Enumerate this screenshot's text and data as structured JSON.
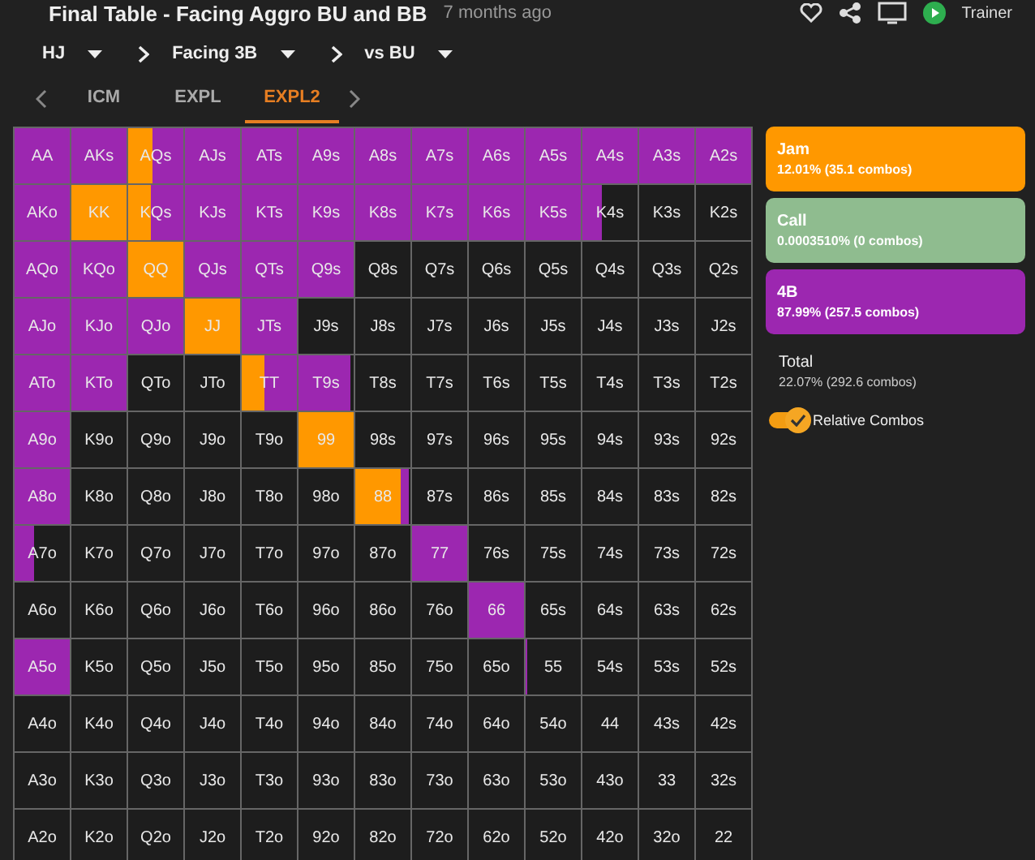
{
  "header": {
    "title": "Final Table - Facing Aggro BU and BB",
    "time": "7 months ago",
    "trainer_label": "Trainer"
  },
  "breadcrumbs": [
    {
      "label": "HJ"
    },
    {
      "label": "Facing 3B"
    },
    {
      "label": "vs BU"
    }
  ],
  "tabs": [
    {
      "label": "ICM",
      "selected": false
    },
    {
      "label": "EXPL",
      "selected": false
    },
    {
      "label": "EXPL2",
      "selected": true
    }
  ],
  "grid": [
    [
      {
        "hand": "AA",
        "segments": [
          {
            "kind": "fourbet",
            "level": 1
          }
        ]
      },
      {
        "hand": "AKs",
        "segments": [
          {
            "kind": "fourbet",
            "level": 1
          }
        ]
      },
      {
        "hand": "AQs",
        "segments": [
          {
            "kind": "jam",
            "level": 0.45
          },
          {
            "kind": "fourbet",
            "level": 0.55
          }
        ]
      },
      {
        "hand": "AJs",
        "segments": [
          {
            "kind": "fourbet",
            "level": 1
          }
        ]
      },
      {
        "hand": "ATs",
        "segments": [
          {
            "kind": "fourbet",
            "level": 1
          }
        ]
      },
      {
        "hand": "A9s",
        "segments": [
          {
            "kind": "fourbet",
            "level": 1
          }
        ]
      },
      {
        "hand": "A8s",
        "segments": [
          {
            "kind": "fourbet",
            "level": 1
          }
        ]
      },
      {
        "hand": "A7s",
        "segments": [
          {
            "kind": "fourbet",
            "level": 1
          }
        ]
      },
      {
        "hand": "A6s",
        "segments": [
          {
            "kind": "fourbet",
            "level": 1
          }
        ]
      },
      {
        "hand": "A5s",
        "segments": [
          {
            "kind": "fourbet",
            "level": 1
          }
        ]
      },
      {
        "hand": "A4s",
        "segments": [
          {
            "kind": "fourbet",
            "level": 1
          }
        ]
      },
      {
        "hand": "A3s",
        "segments": [
          {
            "kind": "fourbet",
            "level": 1
          }
        ]
      },
      {
        "hand": "A2s",
        "segments": [
          {
            "kind": "fourbet",
            "level": 1
          }
        ]
      }
    ],
    [
      {
        "hand": "AKo",
        "segments": [
          {
            "kind": "fourbet",
            "level": 1
          }
        ]
      },
      {
        "hand": "KK",
        "segments": [
          {
            "kind": "jam",
            "level": 1
          }
        ]
      },
      {
        "hand": "KQs",
        "segments": [
          {
            "kind": "jam",
            "level": 0.4
          },
          {
            "kind": "fourbet",
            "level": 0.6
          }
        ]
      },
      {
        "hand": "KJs",
        "segments": [
          {
            "kind": "fourbet",
            "level": 1
          }
        ]
      },
      {
        "hand": "KTs",
        "segments": [
          {
            "kind": "fourbet",
            "level": 1
          }
        ]
      },
      {
        "hand": "K9s",
        "segments": [
          {
            "kind": "fourbet",
            "level": 1
          }
        ]
      },
      {
        "hand": "K8s",
        "segments": [
          {
            "kind": "fourbet",
            "level": 1
          }
        ]
      },
      {
        "hand": "K7s",
        "segments": [
          {
            "kind": "fourbet",
            "level": 1
          }
        ]
      },
      {
        "hand": "K6s",
        "segments": [
          {
            "kind": "fourbet",
            "level": 1
          }
        ]
      },
      {
        "hand": "K5s",
        "segments": [
          {
            "kind": "fourbet",
            "level": 1
          }
        ]
      },
      {
        "hand": "K4s",
        "segments": [
          {
            "kind": "fourbet",
            "level": 0.35
          }
        ]
      },
      {
        "hand": "K3s"
      },
      {
        "hand": "K2s"
      }
    ],
    [
      {
        "hand": "AQo",
        "segments": [
          {
            "kind": "fourbet",
            "level": 1
          }
        ]
      },
      {
        "hand": "KQo",
        "segments": [
          {
            "kind": "fourbet",
            "level": 1
          }
        ]
      },
      {
        "hand": "QQ",
        "segments": [
          {
            "kind": "jam",
            "level": 1
          }
        ]
      },
      {
        "hand": "QJs",
        "segments": [
          {
            "kind": "fourbet",
            "level": 1
          }
        ]
      },
      {
        "hand": "QTs",
        "segments": [
          {
            "kind": "fourbet",
            "level": 1
          }
        ]
      },
      {
        "hand": "Q9s",
        "segments": [
          {
            "kind": "fourbet",
            "level": 1
          }
        ]
      },
      {
        "hand": "Q8s"
      },
      {
        "hand": "Q7s"
      },
      {
        "hand": "Q6s"
      },
      {
        "hand": "Q5s"
      },
      {
        "hand": "Q4s"
      },
      {
        "hand": "Q3s"
      },
      {
        "hand": "Q2s"
      }
    ],
    [
      {
        "hand": "AJo",
        "segments": [
          {
            "kind": "fourbet",
            "level": 1
          }
        ]
      },
      {
        "hand": "KJo",
        "segments": [
          {
            "kind": "fourbet",
            "level": 1
          }
        ]
      },
      {
        "hand": "QJo",
        "segments": [
          {
            "kind": "fourbet",
            "level": 1
          }
        ]
      },
      {
        "hand": "JJ",
        "segments": [
          {
            "kind": "jam",
            "level": 1
          }
        ]
      },
      {
        "hand": "JTs",
        "segments": [
          {
            "kind": "fourbet",
            "level": 1
          }
        ]
      },
      {
        "hand": "J9s"
      },
      {
        "hand": "J8s"
      },
      {
        "hand": "J7s"
      },
      {
        "hand": "J6s"
      },
      {
        "hand": "J5s"
      },
      {
        "hand": "J4s"
      },
      {
        "hand": "J3s"
      },
      {
        "hand": "J2s"
      }
    ],
    [
      {
        "hand": "ATo",
        "segments": [
          {
            "kind": "fourbet",
            "level": 1
          }
        ]
      },
      {
        "hand": "KTo",
        "segments": [
          {
            "kind": "fourbet",
            "level": 1
          }
        ]
      },
      {
        "hand": "QTo"
      },
      {
        "hand": "JTo"
      },
      {
        "hand": "TT",
        "segments": [
          {
            "kind": "jam",
            "level": 0.4
          },
          {
            "kind": "fourbet",
            "level": 0.6
          }
        ]
      },
      {
        "hand": "T9s",
        "segments": [
          {
            "kind": "fourbet",
            "level": 0.95
          }
        ]
      },
      {
        "hand": "T8s"
      },
      {
        "hand": "T7s"
      },
      {
        "hand": "T6s"
      },
      {
        "hand": "T5s"
      },
      {
        "hand": "T4s"
      },
      {
        "hand": "T3s"
      },
      {
        "hand": "T2s"
      }
    ],
    [
      {
        "hand": "A9o",
        "segments": [
          {
            "kind": "fourbet",
            "level": 1
          }
        ]
      },
      {
        "hand": "K9o"
      },
      {
        "hand": "Q9o"
      },
      {
        "hand": "J9o"
      },
      {
        "hand": "T9o"
      },
      {
        "hand": "99",
        "segments": [
          {
            "kind": "jam",
            "level": 1
          }
        ]
      },
      {
        "hand": "98s"
      },
      {
        "hand": "97s"
      },
      {
        "hand": "96s"
      },
      {
        "hand": "95s"
      },
      {
        "hand": "94s"
      },
      {
        "hand": "93s"
      },
      {
        "hand": "92s"
      }
    ],
    [
      {
        "hand": "A8o",
        "segments": [
          {
            "kind": "fourbet",
            "level": 1
          }
        ]
      },
      {
        "hand": "K8o"
      },
      {
        "hand": "Q8o"
      },
      {
        "hand": "J8o"
      },
      {
        "hand": "T8o"
      },
      {
        "hand": "98o"
      },
      {
        "hand": "88",
        "segments": [
          {
            "kind": "jam",
            "level": 0.83
          },
          {
            "kind": "fourbet",
            "level": 0.14
          }
        ]
      },
      {
        "hand": "87s"
      },
      {
        "hand": "86s"
      },
      {
        "hand": "85s"
      },
      {
        "hand": "84s"
      },
      {
        "hand": "83s"
      },
      {
        "hand": "82s"
      }
    ],
    [
      {
        "hand": "A7o",
        "segments": [
          {
            "kind": "fourbet",
            "level": 0.35
          }
        ]
      },
      {
        "hand": "K7o"
      },
      {
        "hand": "Q7o"
      },
      {
        "hand": "J7o"
      },
      {
        "hand": "T7o"
      },
      {
        "hand": "97o"
      },
      {
        "hand": "87o"
      },
      {
        "hand": "77",
        "segments": [
          {
            "kind": "fourbet",
            "level": 1
          }
        ]
      },
      {
        "hand": "76s"
      },
      {
        "hand": "75s"
      },
      {
        "hand": "74s"
      },
      {
        "hand": "73s"
      },
      {
        "hand": "72s"
      }
    ],
    [
      {
        "hand": "A6o"
      },
      {
        "hand": "K6o"
      },
      {
        "hand": "Q6o"
      },
      {
        "hand": "J6o"
      },
      {
        "hand": "T6o"
      },
      {
        "hand": "96o"
      },
      {
        "hand": "86o"
      },
      {
        "hand": "76o"
      },
      {
        "hand": "66",
        "segments": [
          {
            "kind": "fourbet",
            "level": 1
          }
        ]
      },
      {
        "hand": "65s"
      },
      {
        "hand": "64s"
      },
      {
        "hand": "63s"
      },
      {
        "hand": "62s"
      }
    ],
    [
      {
        "hand": "A5o",
        "segments": [
          {
            "kind": "fourbet",
            "level": 1
          }
        ]
      },
      {
        "hand": "K5o"
      },
      {
        "hand": "Q5o"
      },
      {
        "hand": "J5o"
      },
      {
        "hand": "T5o"
      },
      {
        "hand": "95o"
      },
      {
        "hand": "85o"
      },
      {
        "hand": "75o"
      },
      {
        "hand": "65o"
      },
      {
        "hand": "55",
        "segments": [
          {
            "kind": "fourbet",
            "level": 0.04
          }
        ]
      },
      {
        "hand": "54s"
      },
      {
        "hand": "53s"
      },
      {
        "hand": "52s"
      }
    ],
    [
      {
        "hand": "A4o"
      },
      {
        "hand": "K4o"
      },
      {
        "hand": "Q4o"
      },
      {
        "hand": "J4o"
      },
      {
        "hand": "T4o"
      },
      {
        "hand": "94o"
      },
      {
        "hand": "84o"
      },
      {
        "hand": "74o"
      },
      {
        "hand": "64o"
      },
      {
        "hand": "54o"
      },
      {
        "hand": "44"
      },
      {
        "hand": "43s"
      },
      {
        "hand": "42s"
      }
    ],
    [
      {
        "hand": "A3o"
      },
      {
        "hand": "K3o"
      },
      {
        "hand": "Q3o"
      },
      {
        "hand": "J3o"
      },
      {
        "hand": "T3o"
      },
      {
        "hand": "93o"
      },
      {
        "hand": "83o"
      },
      {
        "hand": "73o"
      },
      {
        "hand": "63o"
      },
      {
        "hand": "53o"
      },
      {
        "hand": "43o"
      },
      {
        "hand": "33"
      },
      {
        "hand": "32s"
      }
    ],
    [
      {
        "hand": "A2o"
      },
      {
        "hand": "K2o"
      },
      {
        "hand": "Q2o"
      },
      {
        "hand": "J2o"
      },
      {
        "hand": "T2o"
      },
      {
        "hand": "92o"
      },
      {
        "hand": "82o"
      },
      {
        "hand": "72o"
      },
      {
        "hand": "62o"
      },
      {
        "hand": "52o"
      },
      {
        "hand": "42o"
      },
      {
        "hand": "32o"
      },
      {
        "hand": "22"
      }
    ]
  ],
  "legend": [
    {
      "kind": "jam",
      "name": "Jam",
      "detail": "12.01% (35.1 combos)",
      "color": "#ff9800"
    },
    {
      "kind": "call",
      "name": "Call",
      "detail": "0.0003510% (0 combos)",
      "color": "#8fbc8f"
    },
    {
      "kind": "fourbet",
      "name": "4B",
      "detail": "87.99% (257.5 combos)",
      "color": "#9c27b0"
    }
  ],
  "total": {
    "label": "Total",
    "detail": "22.07% (292.6 combos)"
  },
  "toggle": {
    "label": "Relative Combos",
    "checked": true
  }
}
